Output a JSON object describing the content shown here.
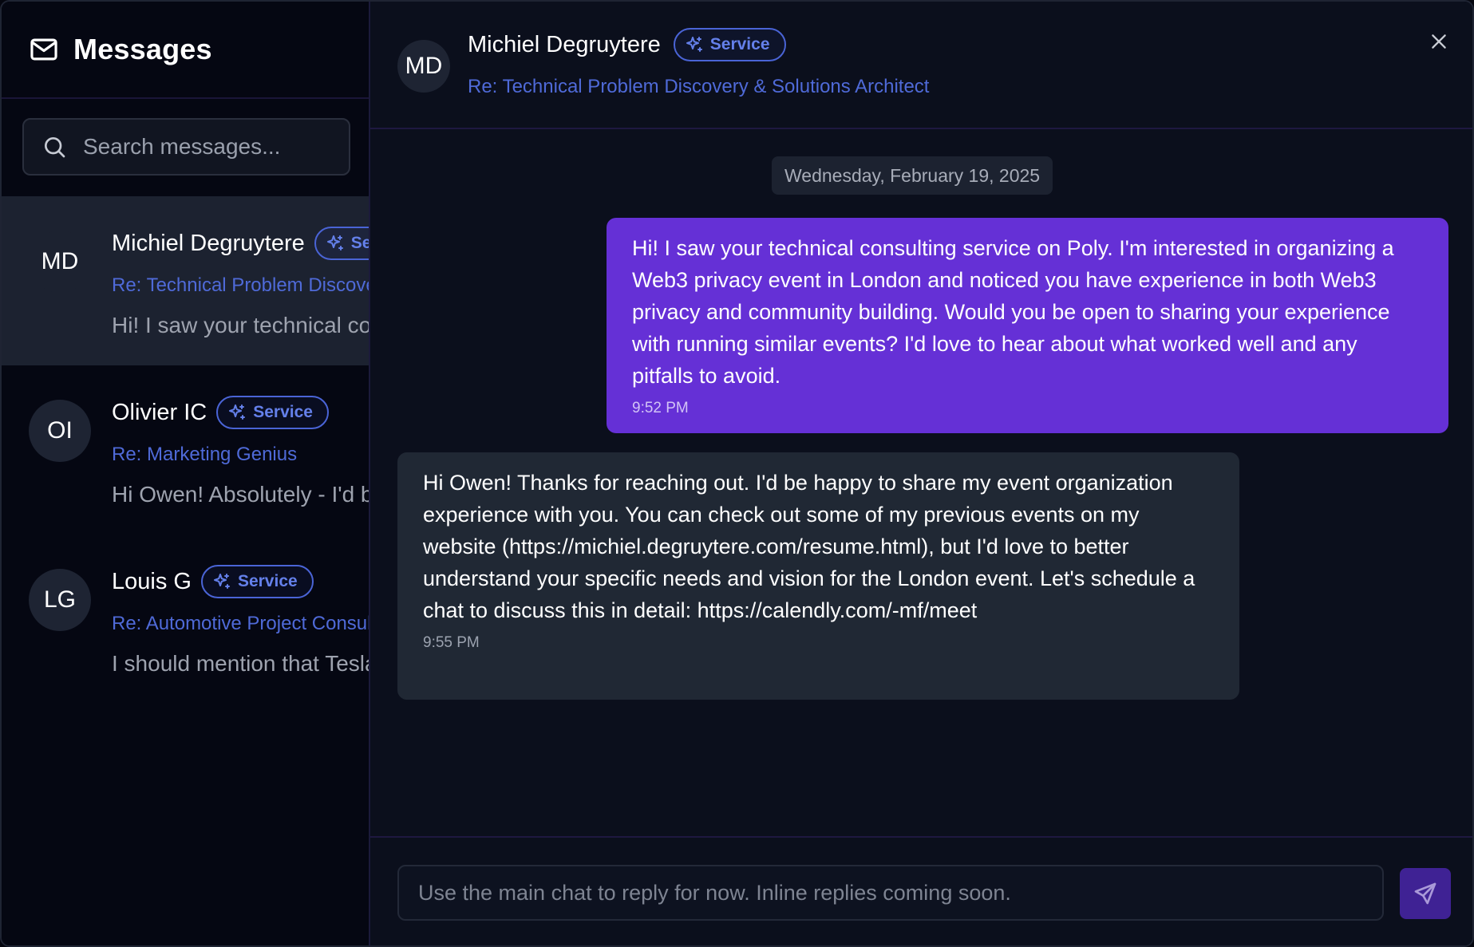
{
  "sidebar": {
    "title": "Messages",
    "search": {
      "placeholder": "Search messages...",
      "value": ""
    },
    "conversations": [
      {
        "initials": "MD",
        "name": "Michiel Degruytere",
        "badge": "Service",
        "subject": "Re: Technical Problem Discovery & Solutions Architect",
        "preview": "Hi! I saw your technical consulting service on Poly. I'm interested in organizing a Web3 privacy event in London",
        "active": true
      },
      {
        "initials": "OI",
        "name": "Olivier IC",
        "badge": "Service",
        "subject": "Re: Marketing Genius",
        "preview": "Hi Owen! Absolutely - I'd be happy to help",
        "active": false
      },
      {
        "initials": "LG",
        "name": "Louis G",
        "badge": "Service",
        "subject": "Re: Automotive Project Consulting",
        "preview": "I should mention that Tesla",
        "active": false
      }
    ]
  },
  "panel": {
    "header": {
      "initials": "MD",
      "name": "Michiel Degruytere",
      "badge": "Service",
      "subject": "Re: Technical Problem Discovery & Solutions Architect"
    },
    "date": "Wednesday, February 19, 2025",
    "messages": [
      {
        "direction": "outgoing",
        "text": "Hi! I saw your technical consulting service on Poly. I'm interested in organizing a Web3 privacy event in London and noticed you have experience in both Web3 privacy and community building. Would you be open to sharing your experience with running similar events? I'd love to hear about what worked well and any pitfalls to avoid.",
        "time": "9:52 PM"
      },
      {
        "direction": "incoming",
        "text": "Hi Owen! Thanks for reaching out. I'd be happy to share my event organization experience with you. You can check out some of my previous events on my website (https://michiel.degruytere.com/resume.html), but I'd love to better understand your specific needs and vision for the London event. Let's schedule a chat to discuss this in detail: https://calendly.com/-mf/meet",
        "time": "9:55 PM"
      }
    ],
    "composer": {
      "placeholder": "Use the main chat to reply for now. Inline replies coming soon.",
      "value": ""
    }
  },
  "icons": {
    "mail": "mail-icon",
    "search": "search-icon",
    "sparkle": "sparkle-icon",
    "close": "close-icon",
    "send": "send-icon"
  },
  "colors": {
    "accent_purple": "#6530d6",
    "link_blue": "#4f6ad8",
    "badge_blue": "#6480ea",
    "background": "#0b0f1c",
    "sidebar_background": "#050712"
  }
}
